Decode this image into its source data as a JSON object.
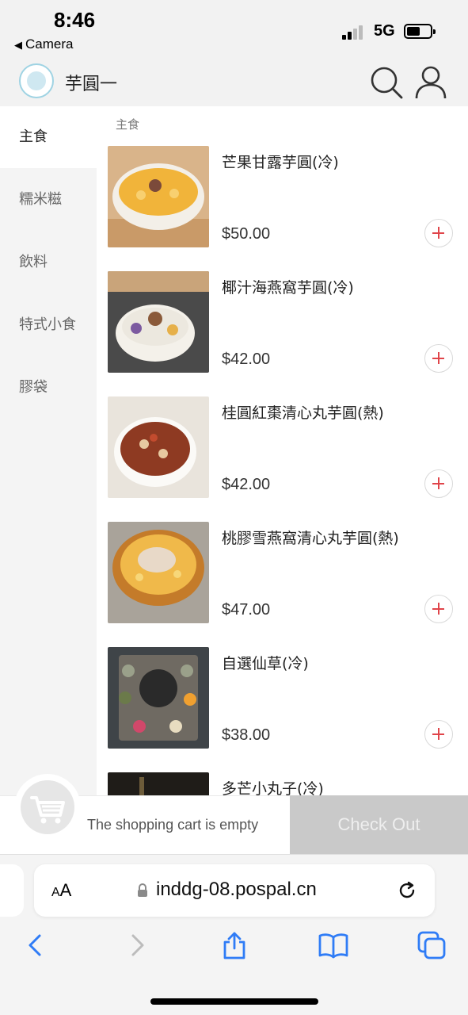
{
  "status_bar": {
    "time": "8:46",
    "back_app": "Camera",
    "network": "5G"
  },
  "header": {
    "shop_name": "芋圓一",
    "logo_icon": "taro-ball-logo",
    "search_icon": "search-icon",
    "account_icon": "user-icon"
  },
  "sidebar": {
    "categories": [
      {
        "label": "主食",
        "active": true
      },
      {
        "label": "糯米糍",
        "active": false
      },
      {
        "label": "飲料",
        "active": false
      },
      {
        "label": "特式小食",
        "active": false
      },
      {
        "label": "膠袋",
        "active": false
      }
    ]
  },
  "main": {
    "section_title": "主食",
    "products": [
      {
        "name": "芒果甘露芋圓(冷)",
        "price": "$50.00"
      },
      {
        "name": "椰汁海燕窩芋圓(冷)",
        "price": "$42.00"
      },
      {
        "name": "桂圓紅棗清心丸芋圓(熱)",
        "price": "$42.00"
      },
      {
        "name": "桃膠雪燕窩清心丸芋圓(熱)",
        "price": "$47.00"
      },
      {
        "name": "自選仙草(冷)",
        "price": "$38.00"
      },
      {
        "name": "多芒小丸子(冷)",
        "price": ""
      }
    ]
  },
  "cart": {
    "empty_text": "The shopping cart is empty",
    "checkout_label": "Check Out",
    "cart_icon": "cart-icon"
  },
  "browser": {
    "aa_small": "A",
    "aa_big": "A",
    "url": "inddg-08.pospal.cn"
  },
  "colors": {
    "accent_red": "#e0454a",
    "sidebar_bg": "#f4f4f4",
    "checkout_bg": "#c9c9c9"
  }
}
